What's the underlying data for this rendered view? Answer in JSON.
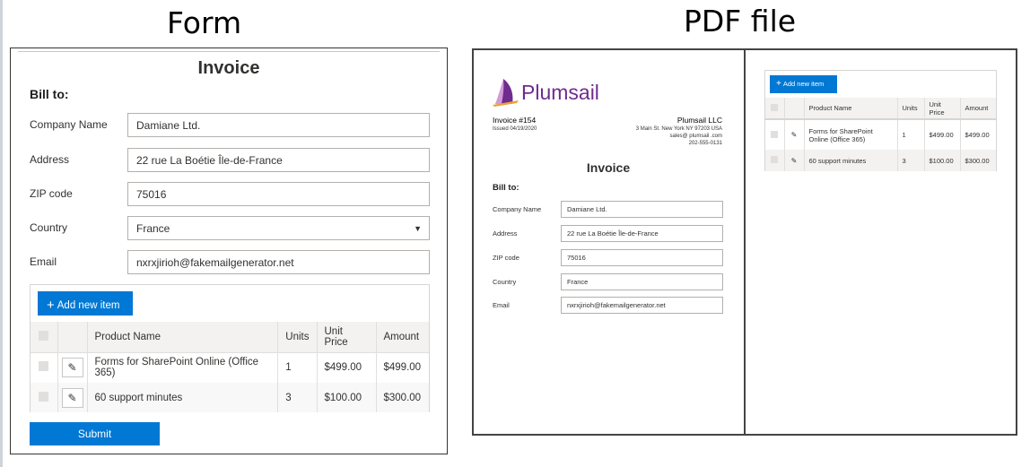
{
  "captions": {
    "form": "Form",
    "pdf": "PDF file"
  },
  "form": {
    "title": "Invoice",
    "bill_to": "Bill to:",
    "fields": {
      "company": {
        "label": "Company Name",
        "value": "Damiane Ltd."
      },
      "address": {
        "label": "Address",
        "value": "22 rue La Boétie Île-de-France"
      },
      "zip": {
        "label": "ZIP code",
        "value": "75016"
      },
      "country": {
        "label": "Country",
        "value": "France"
      },
      "email": {
        "label": "Email",
        "value": "nxrxjirioh@fakemailgenerator.net"
      }
    },
    "add_item": "Add new item",
    "columns": {
      "product": "Product Name",
      "units": "Units",
      "unit_price": "Unit Price",
      "amount": "Amount"
    },
    "rows": [
      {
        "product": "Forms for SharePoint Online (Office 365)",
        "units": "1",
        "unit_price": "$499.00",
        "amount": "$499.00"
      },
      {
        "product": "60 support minutes",
        "units": "3",
        "unit_price": "$100.00",
        "amount": "$300.00"
      }
    ],
    "submit": "Submit"
  },
  "pdf": {
    "logo_text": "Plumsail",
    "invoice_number": "Invoice #154",
    "issued": "Issued 04/19/2020",
    "company": {
      "name": "Plumsail LLC",
      "address": "3 Main St. New York NY 97203 USA",
      "email": "sales@ plumsail .com",
      "phone": "202-555-0131"
    },
    "title": "Invoice",
    "bill_to": "Bill to:",
    "fields": {
      "company": {
        "label": "Company Name",
        "value": "Damiane Ltd."
      },
      "address": {
        "label": "Address",
        "value": "22 rue La Boétie Île-de-France"
      },
      "zip": {
        "label": "ZIP code",
        "value": "75016"
      },
      "country": {
        "label": "Country",
        "value": "France"
      },
      "email": {
        "label": "Email",
        "value": "nxrxjirioh@fakemailgenerator.net"
      }
    },
    "add_item": "Add new item",
    "columns": {
      "product": "Product Name",
      "units": "Units",
      "unit_price": "Unit Price",
      "amount": "Amount"
    },
    "rows": [
      {
        "product": "Forms for SharePoint Online (Office 365)",
        "units": "1",
        "unit_price": "$499.00",
        "amount": "$499.00"
      },
      {
        "product": "60 support minutes",
        "units": "3",
        "unit_price": "$100.00",
        "amount": "$300.00"
      }
    ]
  },
  "icons": {
    "add": "plus-icon",
    "edit": "pencil-icon",
    "dropdown": "chevron-down-icon",
    "logo": "plumsail-sail-icon"
  },
  "colors": {
    "accent": "#0078d4",
    "brand": "#6e2c8f",
    "brand_light": "#d39bd6",
    "logo_accent": "#e8a33a"
  }
}
